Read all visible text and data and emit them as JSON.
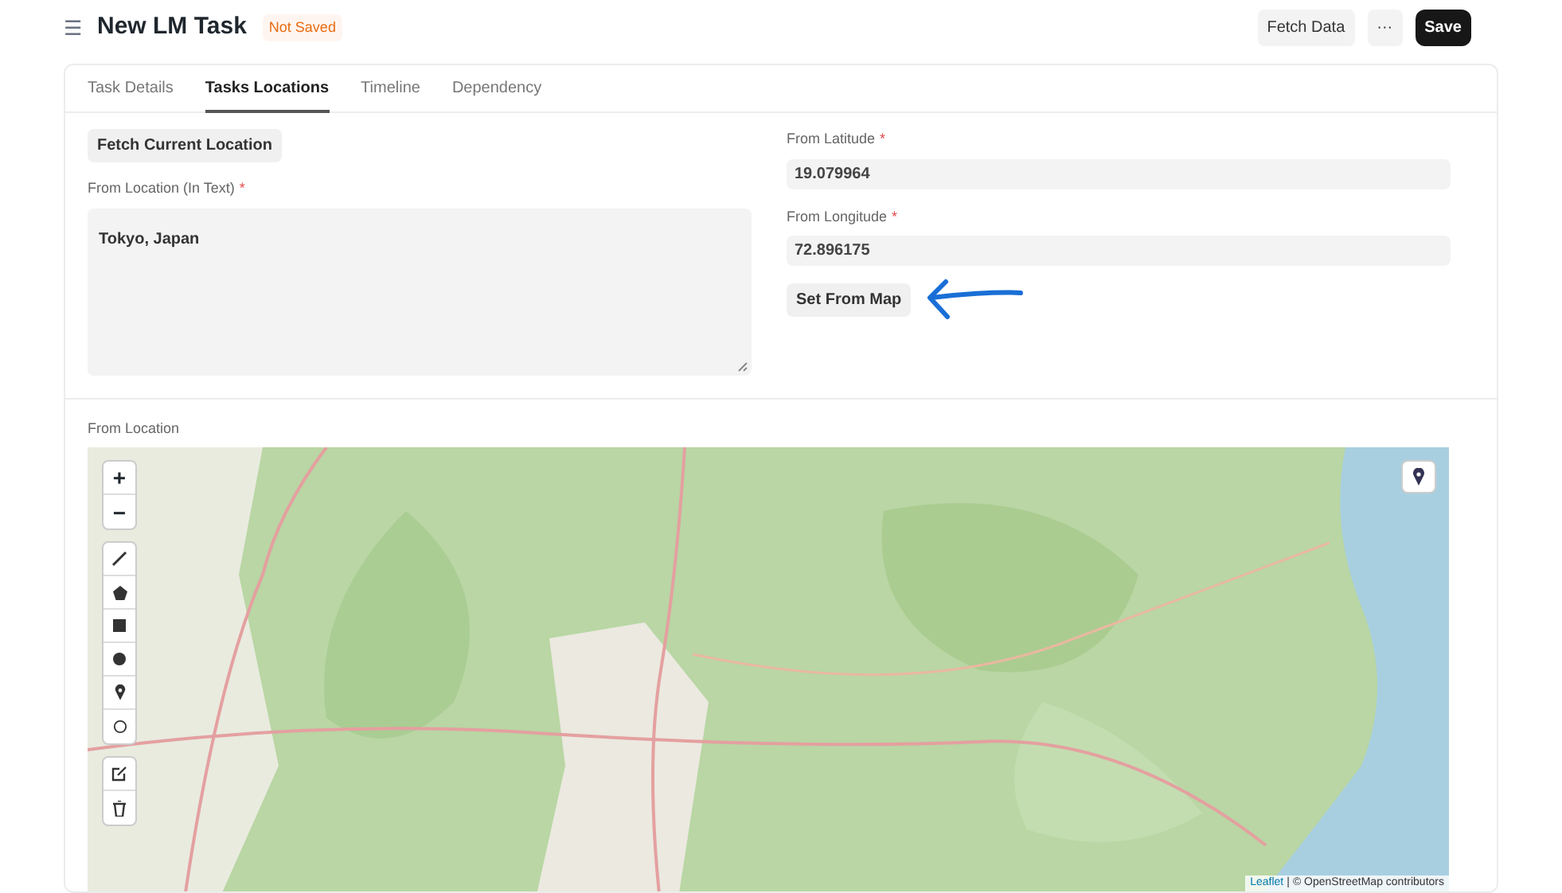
{
  "header": {
    "menu_icon": "☰",
    "title": "New LM Task",
    "status": "Not Saved",
    "actions": [
      {
        "label": "Fetch Data",
        "kind": "secondary"
      },
      {
        "label": "···",
        "kind": "secondary"
      },
      {
        "label": "Save",
        "kind": "primary"
      }
    ]
  },
  "tabs": [
    {
      "label": "Task Details",
      "selected": false
    },
    {
      "label": "Tasks Locations",
      "selected": true
    },
    {
      "label": "Timeline",
      "selected": false
    },
    {
      "label": "Dependency",
      "selected": false
    }
  ],
  "left_column": {
    "button": "Fetch Current Location",
    "field": {
      "label": "From Location (In Text)",
      "required_mark": "*",
      "value": "Tokyo, Japan"
    }
  },
  "right_column": {
    "fields": [
      {
        "label": "From Latitude",
        "required_mark": "*",
        "value": "19.079964"
      },
      {
        "label": "From Longitude",
        "required_mark": "*",
        "value": "72.896175"
      }
    ],
    "button": "Set From Map"
  },
  "map": {
    "label": "From Location",
    "zoom_controls": [
      "+",
      "−"
    ],
    "attribution": {
      "link": "Leaflet",
      "separator": "|",
      "text": "© OpenStreetMap contributors"
    }
  }
}
